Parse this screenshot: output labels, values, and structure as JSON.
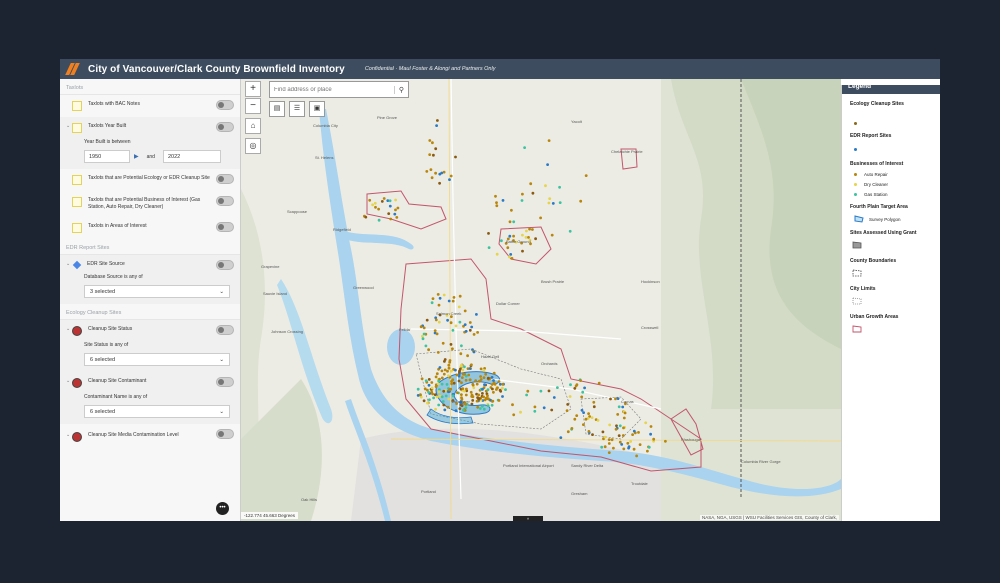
{
  "app": {
    "title": "City of Vancouver/Clark County Brownfield Inventory",
    "subtitle": "Confidential · Maul Foster & Alongi and Partners Only"
  },
  "panel": {
    "sections": {
      "taxlots": "Taxlots",
      "edr": "EDR Report Sites",
      "ecology": "Ecology Cleanup Sites"
    },
    "taxlots": {
      "bac_notes": "Taxlots with BAC Notes",
      "year_built": "Taxlots Year Built",
      "year_between": "Year Built is between",
      "year_from": "1950",
      "year_and": "and",
      "year_to": "2022",
      "potential_ecology": "Taxlots that are Potential Ecology or EDR Cleanup Site",
      "potential_business": "Taxlots that are Potential Business of Interest (Gas Station, Auto Repair, Dry Cleaner)",
      "areas_interest": "Taxlots in Areas of Interest"
    },
    "edr": {
      "site_source": "EDR Site Source",
      "db_source_label": "Database Source is any of",
      "db_source_value": "3 selected"
    },
    "ecology": {
      "status": "Cleanup Site Status",
      "status_label": "Site Status is any of",
      "status_value": "6 selected",
      "contaminant": "Cleanup Site Contaminant",
      "contaminant_label": "Contaminant Name is any of",
      "contaminant_value": "6 selected",
      "media": "Cleanup Site Media Contamination Level"
    },
    "fab": "•••"
  },
  "map": {
    "search_placeholder": "Find address or place",
    "coords": "-122.774 45.663 Degrees",
    "attribution": "NASA, NGA, USGS | WSU Facilities Services GIS, County of Clark,",
    "labels": {
      "pine_grove": "Pine Grove",
      "columbia_city": "Columbia City",
      "st_helens": "St. Helens",
      "ridgefield": "Ridgefield",
      "battle_ground": "Battle Ground",
      "salmon_creek": "Salmon Creek",
      "hazel_dell": "Hazel Dell",
      "felida": "Felida",
      "vancouver": "Vancouver",
      "orchards": "Orchards",
      "camas": "Camas",
      "washougal": "Washougal",
      "portland": "Portland",
      "gresham": "Gresham",
      "troutdale": "Troutdale",
      "brush_prairie": "Brush Prairie",
      "chelatchie": "Chelatchie Prairie",
      "yacolt": "Yacolt",
      "crosswell": "Crosswell",
      "scappoose": "Scappoose",
      "sauvie": "Sauvie Island",
      "greenwood": "Greenwood",
      "sauvie_grapes": "Grapevine",
      "oak_hills": "Oak Hills",
      "pdx_airport": "Portland International Airport",
      "sandy_river": "Sandy River Delta",
      "johnson_crossing": "Johnson Crossing",
      "dollar_corner": "Dollar Corner",
      "hockinson": "Hockinson",
      "gorge": "Columbia River Gorge"
    },
    "collapse_arrow": "‹",
    "bottom_tab": "˄"
  },
  "legend": {
    "title": "Legend",
    "ecology": "Ecology Cleanup Sites",
    "edr": "EDR Report Sites",
    "businesses": "Businesses of Interest",
    "auto_repair": "Auto Repair",
    "dry_cleaner": "Dry Cleaner",
    "gas_station": "Gas Station",
    "fourth_plain": "Fourth Plain Target Area",
    "survey_polygon": "Survey Polygon",
    "sites_grant": "Sites Assessed Using Grant",
    "county": "County Boundaries",
    "city": "City Limits",
    "ugb": "Urban Growth Areas",
    "colors": {
      "auto_repair": "#b8860b",
      "dry_cleaner": "#e6d44a",
      "gas_station": "#3cc4a0",
      "edr": "#2a7ac8",
      "ugb": "#c2566b"
    }
  }
}
